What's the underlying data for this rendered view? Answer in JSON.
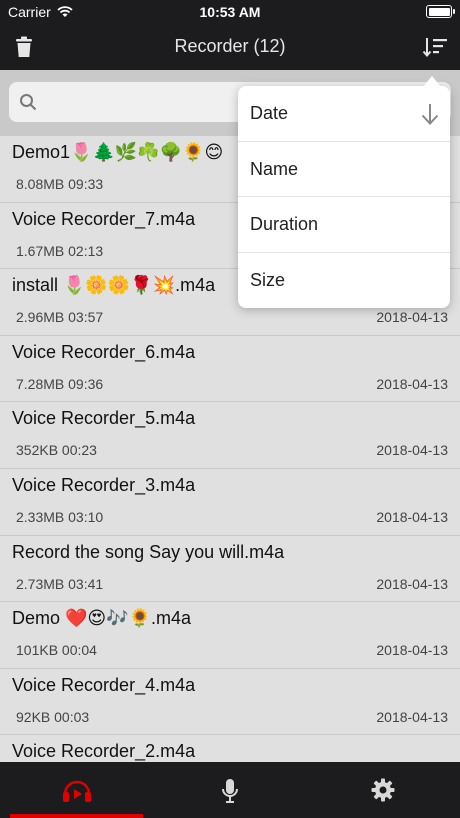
{
  "status": {
    "carrier": "Carrier",
    "time": "10:53 AM"
  },
  "header": {
    "title": "Recorder (12)"
  },
  "search": {
    "placeholder": ""
  },
  "sort_menu": {
    "options": [
      {
        "label": "Date",
        "selected": true
      },
      {
        "label": "Name"
      },
      {
        "label": "Duration"
      },
      {
        "label": "Size"
      }
    ]
  },
  "recordings": [
    {
      "name": "Demo1🌷🌲🌿☘️🌳🌻😊",
      "meta": "8.08MB 09:33",
      "date": ""
    },
    {
      "name": "Voice Recorder_7.m4a",
      "meta": "1.67MB 02:13",
      "date": ""
    },
    {
      "name": "install 🌷🌼🌼🌹💥.m4a",
      "meta": "2.96MB 03:57",
      "date": "2018-04-13"
    },
    {
      "name": "Voice Recorder_6.m4a",
      "meta": "7.28MB 09:36",
      "date": "2018-04-13"
    },
    {
      "name": "Voice Recorder_5.m4a",
      "meta": "352KB 00:23",
      "date": "2018-04-13"
    },
    {
      "name": "Voice Recorder_3.m4a",
      "meta": "2.33MB 03:10",
      "date": "2018-04-13"
    },
    {
      "name": "Record the song Say you will.m4a",
      "meta": "2.73MB 03:41",
      "date": "2018-04-13"
    },
    {
      "name": "Demo ❤️😍🎶🌻.m4a",
      "meta": "101KB 00:04",
      "date": "2018-04-13"
    },
    {
      "name": "Voice Recorder_4.m4a",
      "meta": "92KB 00:03",
      "date": "2018-04-13"
    },
    {
      "name": "Voice Recorder_2.m4a",
      "meta": "",
      "date": ""
    }
  ],
  "tabs": [
    {
      "icon": "play-headphones-icon",
      "active": true
    },
    {
      "icon": "microphone-icon"
    },
    {
      "icon": "gear-icon"
    }
  ],
  "colors": {
    "bar": "#1c1c1e",
    "accent": "#e00000",
    "list_bg": "#e0e0e0"
  }
}
